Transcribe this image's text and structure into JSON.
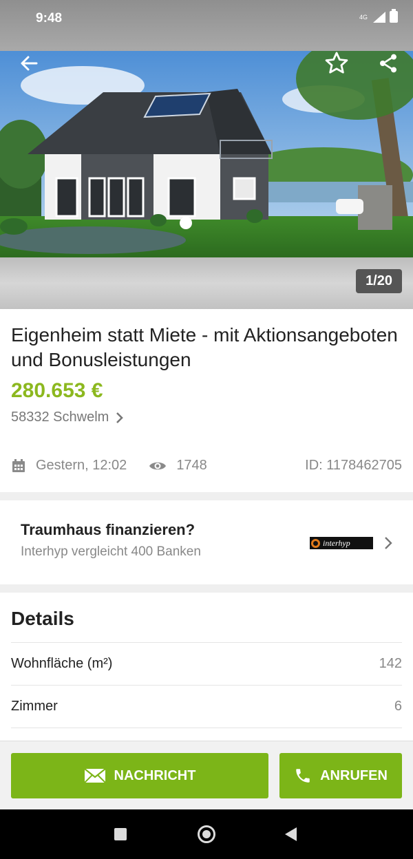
{
  "status_bar": {
    "time": "9:48",
    "network": "4G"
  },
  "gallery": {
    "counter": "1/20"
  },
  "listing": {
    "title": "Eigenheim statt Miete - mit Aktionsangeboten und Bonusleistungen",
    "price": "280.653 €",
    "location": "58332 Schwelm",
    "date": "Gestern, 12:02",
    "views": "1748",
    "id": "ID: 1178462705"
  },
  "finance": {
    "title": "Traumhaus finanzieren?",
    "subtitle": "Interhyp vergleicht 400 Banken",
    "logo_text": "interhyp"
  },
  "details": {
    "heading": "Details",
    "rows": [
      {
        "label": "Wohnfläche (m²)",
        "value": "142"
      },
      {
        "label": "Zimmer",
        "value": "6"
      }
    ]
  },
  "actions": {
    "message_label": "NACHRICHT",
    "call_label": "ANRUFEN"
  },
  "colors": {
    "accent": "#7cb518",
    "price": "#8cb81f"
  },
  "icons": [
    "back-arrow-icon",
    "star-icon",
    "share-icon",
    "calendar-icon",
    "eye-icon",
    "chevron-right-icon",
    "envelope-icon",
    "phone-icon"
  ]
}
